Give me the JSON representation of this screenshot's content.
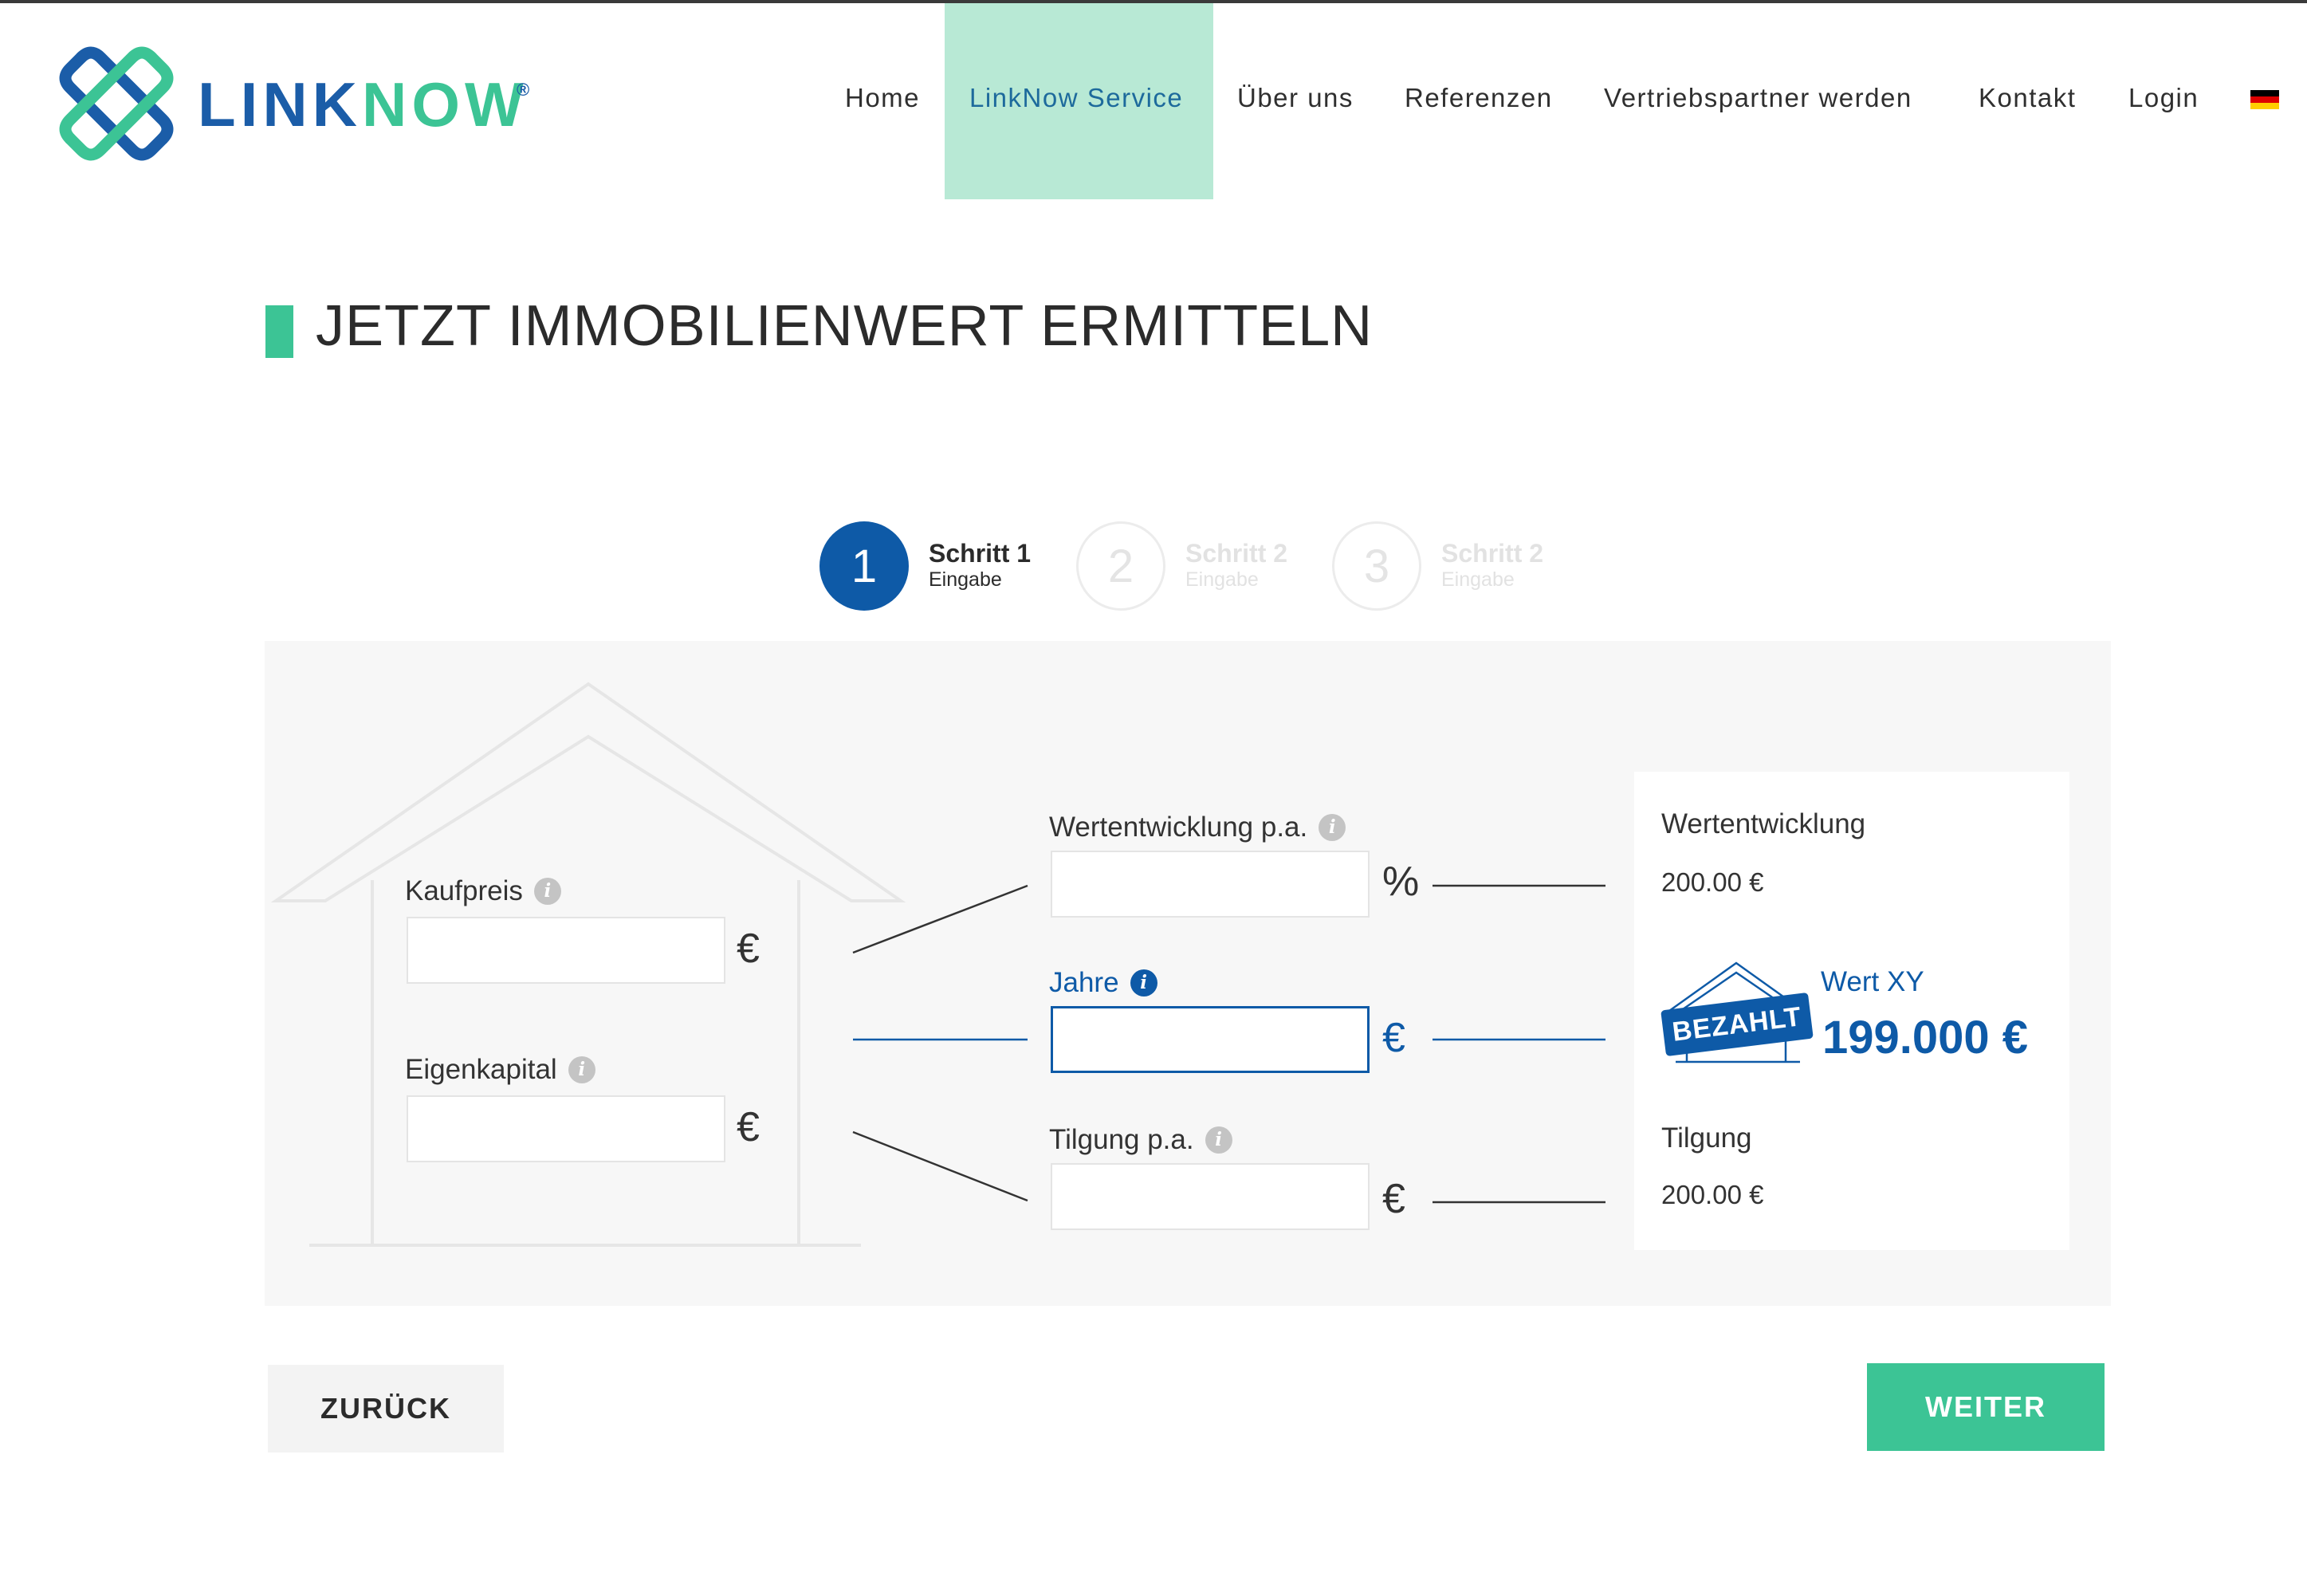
{
  "brand": {
    "name_link": "LINK",
    "name_now": "NOW",
    "reg": "®",
    "primary_color": "#1b5da8",
    "accent_color": "#3cc495"
  },
  "nav": {
    "items": [
      {
        "label": "Home",
        "active": false
      },
      {
        "label": "LinkNow Service",
        "active": true
      },
      {
        "label": "Über uns",
        "active": false
      },
      {
        "label": "Referenzen",
        "active": false
      },
      {
        "label": "Vertriebspartner werden",
        "active": false
      },
      {
        "label": "Kontakt",
        "active": false
      },
      {
        "label": "Login",
        "active": false
      }
    ],
    "language_icon": "german-flag-icon"
  },
  "page_title": "JETZT IMMOBILIENWERT ERMITTELN",
  "steps": [
    {
      "number": "1",
      "title": "Schritt 1",
      "subtitle": "Eingabe",
      "active": true
    },
    {
      "number": "2",
      "title": "Schritt 2",
      "subtitle": "Eingabe",
      "active": false
    },
    {
      "number": "3",
      "title": "Schritt 2",
      "subtitle": "Eingabe",
      "active": false
    }
  ],
  "form": {
    "kaufpreis": {
      "label": "Kaufpreis",
      "value": "",
      "unit": "€"
    },
    "eigenkapital": {
      "label": "Eigenkapital",
      "value": "",
      "unit": "€"
    },
    "wertentwicklung": {
      "label": "Wertentwicklung p.a.",
      "value": "",
      "unit": "%"
    },
    "jahre": {
      "label": "Jahre",
      "value": "",
      "unit": "€"
    },
    "tilgung": {
      "label": "Tilgung p.a.",
      "value": "",
      "unit": "€"
    },
    "info_glyph": "i"
  },
  "result": {
    "wertentwicklung_label": "Wertentwicklung",
    "wertentwicklung_value": "200.00 €",
    "badge": "BEZAHLT",
    "wert_label": "Wert XY",
    "wert_value": "199.000 €",
    "tilgung_label": "Tilgung",
    "tilgung_value": "200.00 €"
  },
  "buttons": {
    "back": "ZURÜCK",
    "next": "WEITER"
  }
}
